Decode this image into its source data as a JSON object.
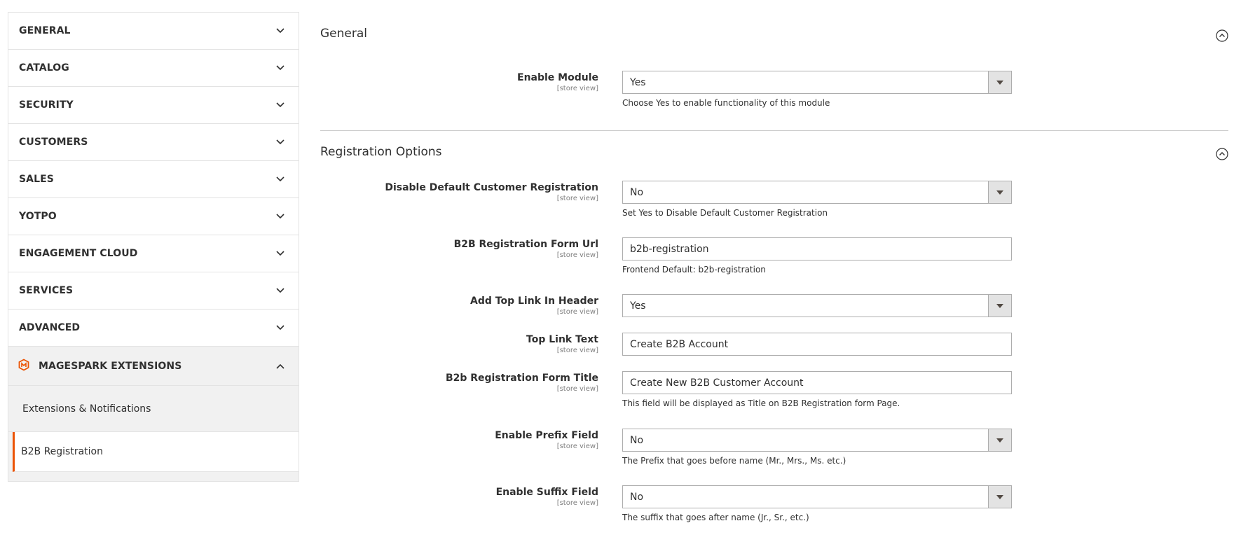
{
  "sidebar": {
    "tabs": [
      {
        "label": "GENERAL"
      },
      {
        "label": "CATALOG"
      },
      {
        "label": "SECURITY"
      },
      {
        "label": "CUSTOMERS"
      },
      {
        "label": "SALES"
      },
      {
        "label": "YOTPO"
      },
      {
        "label": "ENGAGEMENT CLOUD"
      },
      {
        "label": "SERVICES"
      },
      {
        "label": "ADVANCED"
      }
    ],
    "open_tab": {
      "label": "MAGESPARK EXTENSIONS",
      "icon": "magespark-logo-icon"
    },
    "sub_items": [
      {
        "label": "Extensions & Notifications"
      },
      {
        "label": "B2B Registration"
      }
    ],
    "accent_color": "#eb5202"
  },
  "sections": {
    "general": {
      "title": "General",
      "enable_module": {
        "label": "Enable Module",
        "scope": "[store view]",
        "value": "Yes",
        "note": "Choose Yes to enable functionality of this module"
      }
    },
    "registration": {
      "title": "Registration Options",
      "disable_default": {
        "label": "Disable Default Customer Registration",
        "scope": "[store view]",
        "value": "No",
        "note": "Set Yes to Disable Default Customer Registration"
      },
      "form_url": {
        "label": "B2B Registration Form Url",
        "scope": "[store view]",
        "value": "b2b-registration",
        "note": "Frontend Default: b2b-registration"
      },
      "top_link": {
        "label": "Add Top Link In Header",
        "scope": "[store view]",
        "value": "Yes"
      },
      "top_link_text": {
        "label": "Top Link Text",
        "scope": "[store view]",
        "value": "Create B2B Account"
      },
      "form_title": {
        "label": "B2b Registration Form Title",
        "scope": "[store view]",
        "value": "Create New B2B Customer Account",
        "note": "This field will be displayed as Title on B2B Registration form Page."
      },
      "prefix": {
        "label": "Enable Prefix Field",
        "scope": "[store view]",
        "value": "No",
        "note": "The Prefix that goes before name (Mr., Mrs., Ms. etc.)"
      },
      "suffix": {
        "label": "Enable Suffix Field",
        "scope": "[store view]",
        "value": "No",
        "note": "The suffix that goes after name (Jr., Sr., etc.)"
      }
    }
  }
}
